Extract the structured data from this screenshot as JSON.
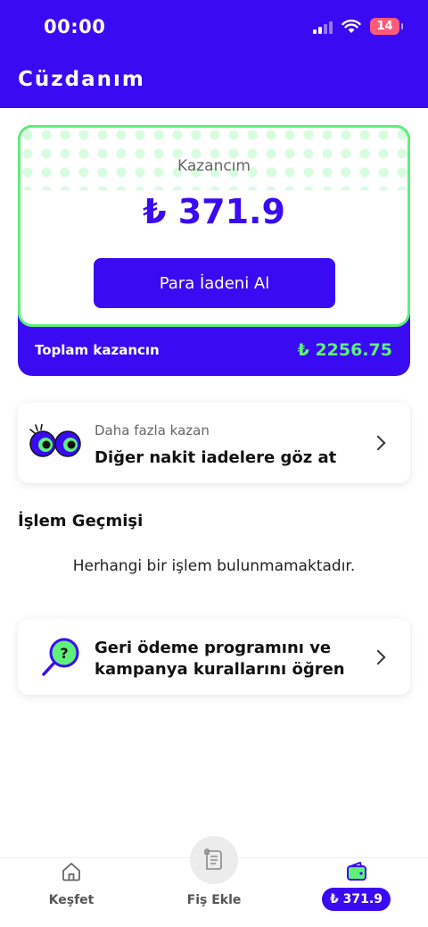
{
  "status_bar": {
    "time": "00:00",
    "battery": "14"
  },
  "header": {
    "title": "Cüzdanım"
  },
  "earnings": {
    "label": "Kazancım",
    "value": "₺ 371.9",
    "button_label": "Para İadeni Al",
    "total_label": "Toplam kazancın",
    "total_value": "₺ 2256.75"
  },
  "more_card": {
    "subtitle": "Daha fazla kazan",
    "title": "Diğer nakit iadelere göz at"
  },
  "history": {
    "title": "İşlem Geçmişi",
    "empty_text": "Herhangi bir işlem bulunmamaktadır."
  },
  "rules_card": {
    "title": "Geri ödeme programını ve kampanya kurallarını öğren"
  },
  "nav": {
    "home_label": "Keşfet",
    "receipt_label": "Fiş Ekle",
    "wallet_value": "₺ 371.9"
  },
  "colors": {
    "primary": "#3a0bf2",
    "accent_green": "#5ff07a"
  }
}
